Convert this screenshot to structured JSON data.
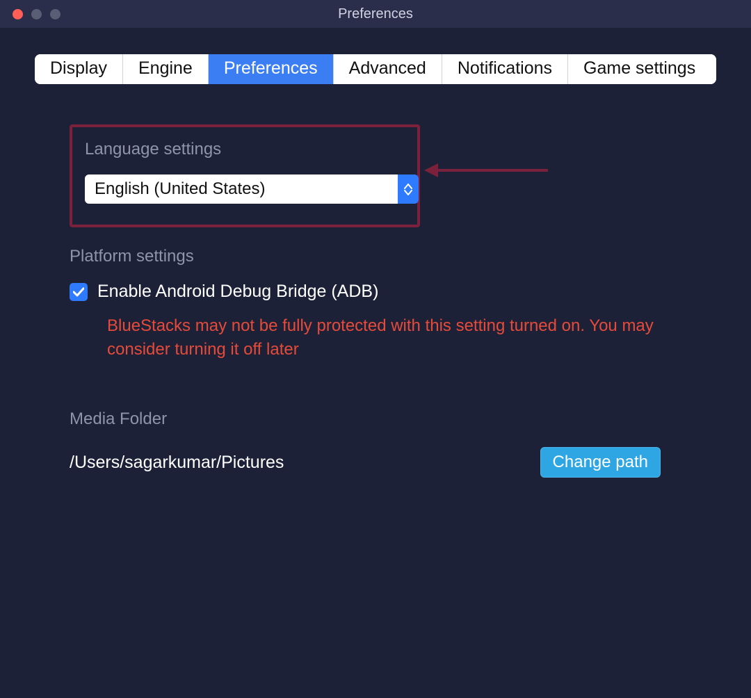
{
  "window": {
    "title": "Preferences"
  },
  "tabs": {
    "items": [
      {
        "label": "Display"
      },
      {
        "label": "Engine"
      },
      {
        "label": "Preferences",
        "active": true
      },
      {
        "label": "Advanced"
      },
      {
        "label": "Notifications"
      },
      {
        "label": "Game settings"
      }
    ]
  },
  "language": {
    "section_label": "Language settings",
    "selected": "English (United States)"
  },
  "platform": {
    "section_label": "Platform settings",
    "adb_label": "Enable Android Debug Bridge (ADB)",
    "adb_checked": true,
    "warning": "BlueStacks may not be fully protected with this setting turned on. You may consider turning it off later"
  },
  "media": {
    "section_label": "Media Folder",
    "path": "/Users/sagarkumar/Pictures",
    "change_button": "Change path"
  },
  "annotation": {
    "highlight": "language-settings",
    "arrow_color": "#7c213b"
  }
}
